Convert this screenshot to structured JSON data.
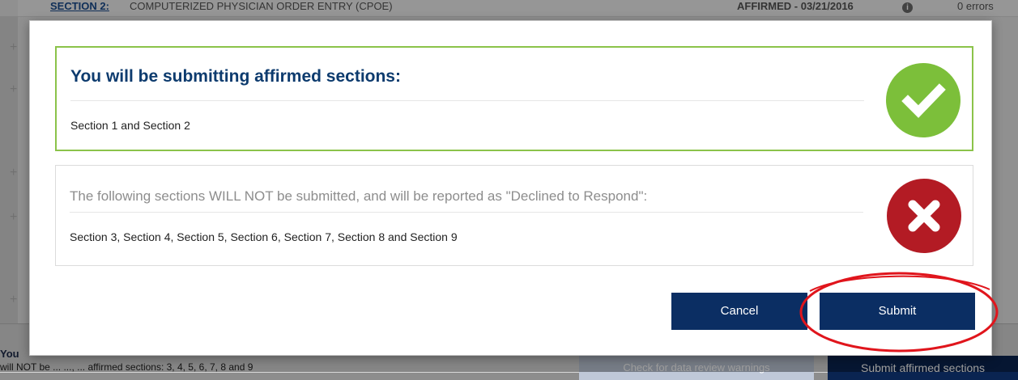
{
  "background": {
    "section_link": "Section 2:",
    "section_title": "COMPUTERIZED PHYSICIAN ORDER ENTRY (CPOE)",
    "affirmed_status": "AFFIRMED - 03/21/2016",
    "errors": "0 errors",
    "info_icon": "info-icon",
    "bottom_heading": "You",
    "bottom_sub": "will NOT be ... ..., ... affirmed sections: 3, 4, 5, 6, 7, 8 and 9",
    "check_button": "Check for data review warnings",
    "submit_affirmed_button": "Submit affirmed sections"
  },
  "modal": {
    "affirmed_panel": {
      "heading": "You will be submitting affirmed sections:",
      "body": "Section 1 and Section 2",
      "icon": "checkmark-circle-icon",
      "accent_color": "#8bc34a"
    },
    "declined_panel": {
      "heading": "The following sections WILL NOT be submitted, and will be reported as \"Declined to Respond\":",
      "body": "Section 3, Section 4, Section 5, Section 6, Section 7, Section 8 and Section 9",
      "icon": "x-circle-icon",
      "accent_color": "#b31b24"
    },
    "cancel_label": "Cancel",
    "submit_label": "Submit"
  },
  "annotation": {
    "highlight": "red-ellipse-around-submit",
    "color": "#e0151c"
  },
  "colors": {
    "primary_button": "#0b2e63",
    "heading_blue": "#0d3b6e"
  }
}
